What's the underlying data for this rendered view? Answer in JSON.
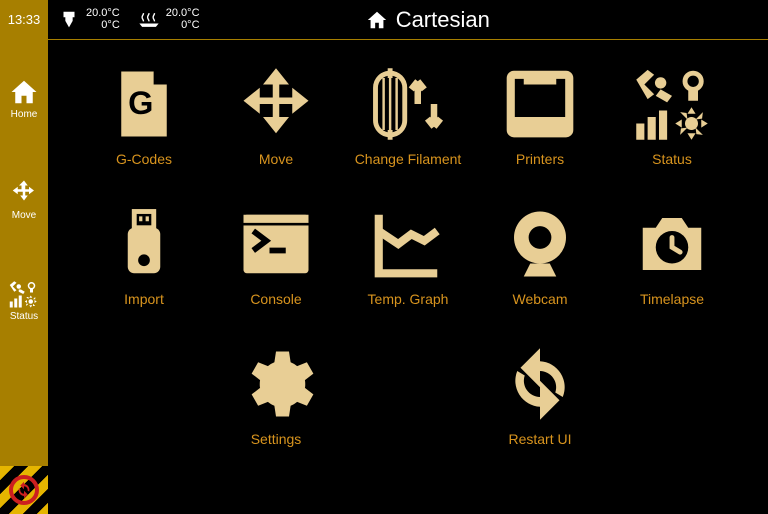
{
  "clock": "13:33",
  "title": "Cartesian",
  "temps": {
    "hotend": {
      "target": "20.0°C",
      "current": "0°C"
    },
    "bed": {
      "target": "20.0°C",
      "current": "0°C"
    }
  },
  "sidebar": {
    "items": [
      {
        "label": "Home"
      },
      {
        "label": "Move"
      },
      {
        "label": "Status"
      }
    ]
  },
  "tiles": {
    "row1": [
      {
        "label": "G-Codes"
      },
      {
        "label": "Move"
      },
      {
        "label": "Change Filament"
      },
      {
        "label": "Printers"
      },
      {
        "label": "Status"
      }
    ],
    "row2": [
      {
        "label": "Import"
      },
      {
        "label": "Console"
      },
      {
        "label": "Temp. Graph"
      },
      {
        "label": "Webcam"
      },
      {
        "label": "Timelapse"
      }
    ],
    "row3": [
      {
        "label": "Settings"
      },
      {
        "label": "Restart UI"
      }
    ]
  }
}
